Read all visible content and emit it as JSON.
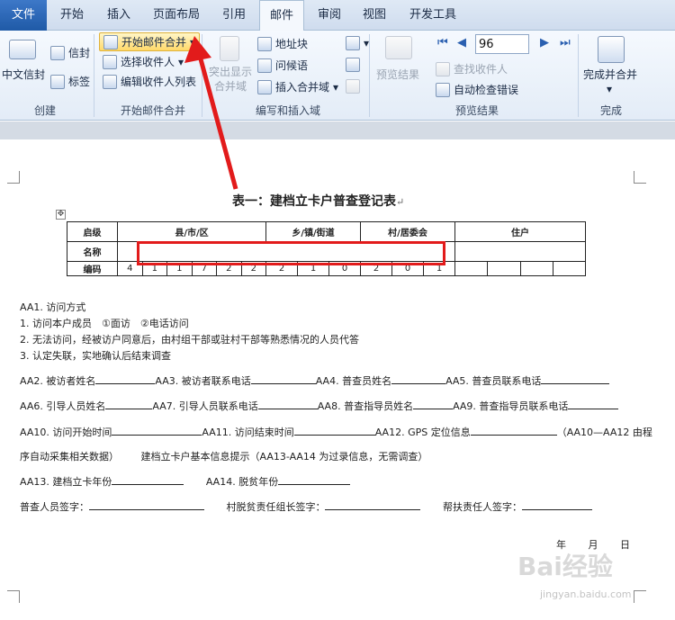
{
  "tabs": [
    "文件",
    "开始",
    "插入",
    "页面布局",
    "引用",
    "邮件",
    "审阅",
    "视图",
    "开发工具"
  ],
  "ribbon": {
    "create": {
      "label": "创建",
      "chinese_envelope": "中文信封",
      "envelopes": "信封",
      "labels": "标签"
    },
    "start_merge": {
      "label": "开始邮件合并",
      "start_mail_merge": "开始邮件合并",
      "select_recipients": "选择收件人",
      "edit_recipients": "编辑收件人列表"
    },
    "write_insert": {
      "label": "编写和插入域",
      "highlight_fields": "突出显示合并域",
      "address_block": "地址块",
      "greeting_line": "问候语",
      "insert_merge_field": "插入合并域"
    },
    "preview": {
      "label": "预览结果",
      "preview_results": "预览结果",
      "find_recipient": "查找收件人",
      "auto_check_errors": "自动检查错误",
      "record_number": "96"
    },
    "finish": {
      "label": "完成",
      "finish_merge": "完成并合并"
    }
  },
  "document": {
    "title": "表一：建档立卡户普查登记表",
    "table": {
      "row1": [
        "启级",
        "县/市/区",
        "乡/镇/街道",
        "村/居委会",
        "住户"
      ],
      "row2_label": "名称",
      "row3_label": "编码",
      "codes": [
        "4",
        "1",
        "1",
        "7",
        "2",
        "2",
        "2",
        "1",
        "0",
        "2",
        "0",
        "1",
        "",
        "",
        "",
        ""
      ]
    },
    "lines": [
      "AA1. 访问方式",
      "1. 访问本户成员　①面访　②电话访问",
      "2. 无法访问，经被访户同意后，由村组干部或驻村干部等熟悉情况的人员代答",
      "3. 认定失联，实地确认后结束调查"
    ],
    "fields": {
      "aa2": "AA2. 被访者姓名",
      "aa3": "AA3. 被访者联系电话",
      "aa4": "AA4. 普查员姓名",
      "aa5": "AA5. 普查员联系电话",
      "aa6": "AA6. 引导人员姓名",
      "aa7": "AA7. 引导人员联系电话",
      "aa8": "AA8. 普查指导员姓名",
      "aa9": "AA9. 普查指导员联系电话",
      "aa10": "AA10. 访问开始时间",
      "aa11": "AA11. 访问结束时间",
      "aa12": "AA12. GPS 定位信息",
      "aa12_note": "（AA10—AA12 由程",
      "aa12_note2": "序自动采集相关数据）",
      "tip": "建档立卡户基本信息提示（AA13-AA14 为过录信息，无需调查）",
      "aa13": "AA13. 建档立卡年份",
      "aa14": "AA14. 脱贫年份",
      "sign1": "普查人员签字：",
      "sign2": "村脱贫责任组长签字：",
      "sign3": "帮扶责任人签字：",
      "date_year": "年",
      "date_month": "月",
      "date_day": "日"
    },
    "watermark": "Bai经验",
    "watermark_url": "jingyan.baidu.com"
  },
  "colors": {
    "highlight_box": "#e21b1b",
    "ribbon_bg": "#e3ecf7",
    "file_tab": "#1f5aa7"
  }
}
